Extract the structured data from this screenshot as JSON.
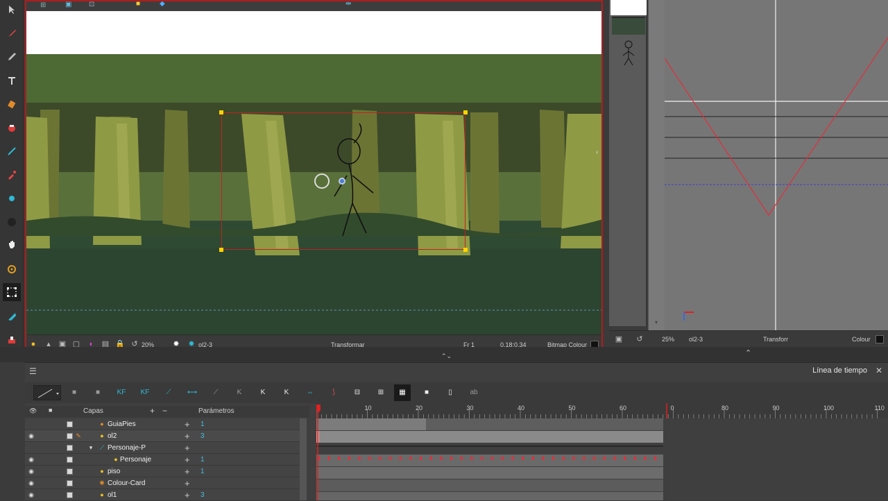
{
  "camera": {
    "status": {
      "zoom": "20%",
      "drawing": "ol2-3",
      "mode": "Transformar",
      "frame": "Fr 1",
      "time": "0.18:0.34",
      "colour": "Bitmap Colour"
    }
  },
  "function_view": {
    "status": {
      "zoom": "25%",
      "drawing": "ol2-3",
      "mode": "Transforr",
      "colour": "Colour"
    }
  },
  "timeline": {
    "title": "Línea de tiempo",
    "close": "✕",
    "header": {
      "layers": "Capas",
      "params": "Parámetros"
    },
    "ruler": [
      "10",
      "20",
      "30",
      "40",
      "50",
      "60",
      "0",
      "80",
      "90",
      "100",
      "110"
    ],
    "layers": [
      {
        "name": "GuiaPies",
        "count": "1"
      },
      {
        "name": "ol2",
        "count": "3"
      },
      {
        "name": "Personaje-P",
        "count": ""
      },
      {
        "name": "Personaje",
        "count": "1"
      },
      {
        "name": "piso",
        "count": "1"
      },
      {
        "name": "Colour-Card",
        "count": ""
      },
      {
        "name": "ol1",
        "count": "3"
      }
    ],
    "toolbar_labels": {
      "kf1": "KF",
      "kf2": "KF"
    }
  },
  "colors": {
    "camera_border": "#b31b1b",
    "accent_cyan": "#2fb9d6",
    "keyframe_red": "#e0303c",
    "playhead": "#e02020"
  }
}
